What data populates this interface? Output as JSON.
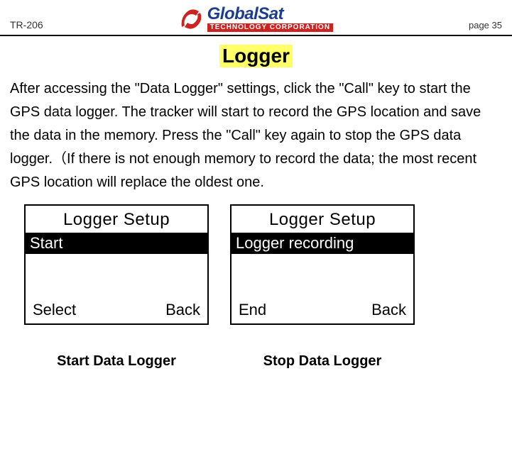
{
  "header": {
    "model": "TR-206",
    "brand_name": "GlobalSat",
    "brand_sub": "TECHNOLOGY CORPORATION",
    "page_label": "page 35"
  },
  "section_title": "Logger",
  "body_paragraph": "After accessing the \"Data Logger\" settings, click the \"Call\" key to start the GPS data logger. The tracker will start to record the GPS location and save the data in the memory. Press the \"Call\" key again to stop the GPS data logger.（If there is not enough memory to record the data; the most recent GPS location will replace the oldest one.",
  "screens": [
    {
      "title": "Logger Setup",
      "status": "Start",
      "soft_left": "Select",
      "soft_right": "Back",
      "caption": "Start Data Logger"
    },
    {
      "title": "Logger Setup",
      "status": "Logger recording",
      "soft_left": "End",
      "soft_right": "Back",
      "caption": "Stop Data Logger"
    }
  ]
}
